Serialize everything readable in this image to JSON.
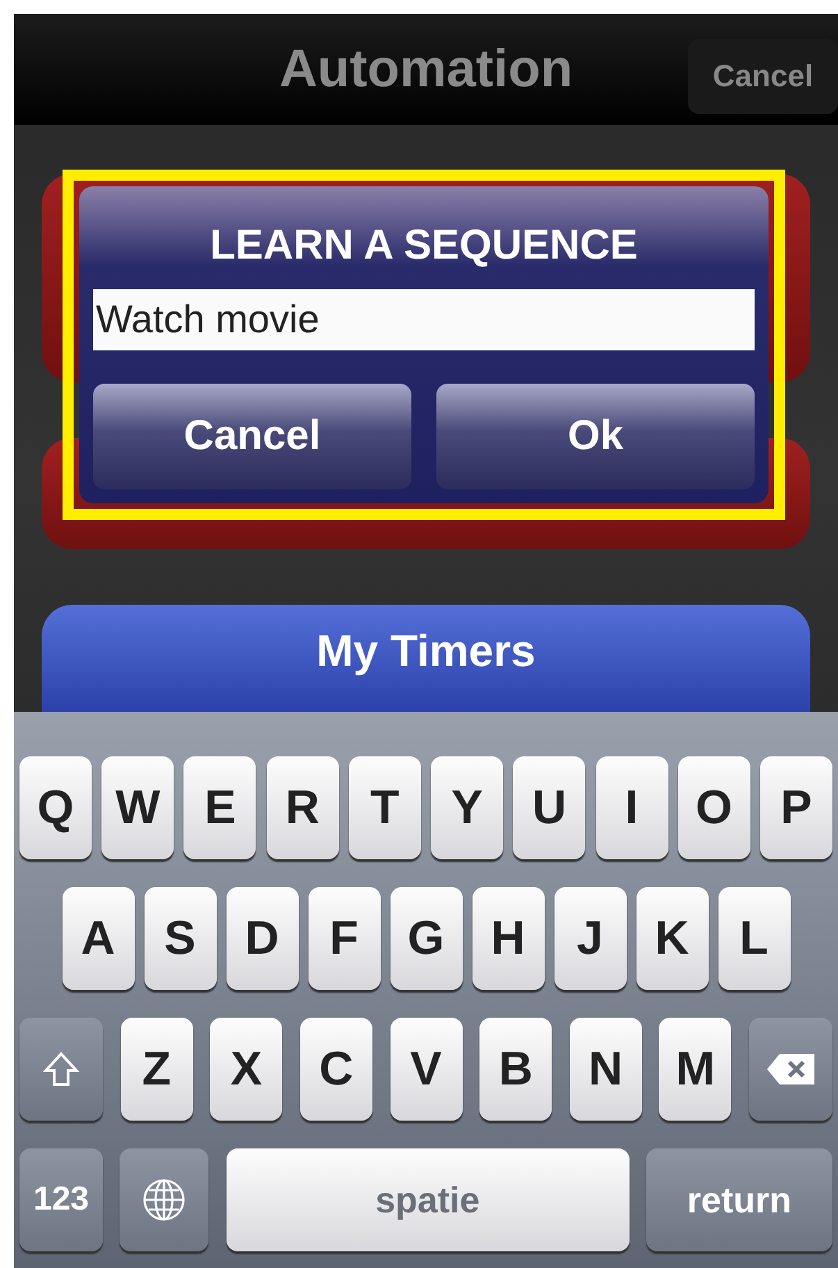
{
  "nav_bar": {
    "title": "Automation",
    "cancel_button": "Cancel"
  },
  "menu": [
    {
      "label": "My Timers"
    }
  ],
  "dialog": {
    "title": "LEARN A SEQUENCE",
    "input": {
      "value": "Watch movie"
    },
    "buttons": [
      "Cancel",
      "Ok"
    ]
  },
  "keyboard": {
    "rows": [
      [
        {
          "kind": "letter",
          "label": "Q"
        },
        {
          "kind": "letter",
          "label": "W"
        },
        {
          "kind": "letter",
          "label": "E"
        },
        {
          "kind": "letter",
          "label": "R"
        },
        {
          "kind": "letter",
          "label": "T"
        },
        {
          "kind": "letter",
          "label": "Y"
        },
        {
          "kind": "letter",
          "label": "U"
        },
        {
          "kind": "letter",
          "label": "I"
        },
        {
          "kind": "letter",
          "label": "O"
        },
        {
          "kind": "letter",
          "label": "P"
        }
      ],
      [
        {
          "kind": "letter",
          "label": "A"
        },
        {
          "kind": "letter",
          "label": "S"
        },
        {
          "kind": "letter",
          "label": "D"
        },
        {
          "kind": "letter",
          "label": "F"
        },
        {
          "kind": "letter",
          "label": "G"
        },
        {
          "kind": "letter",
          "label": "H"
        },
        {
          "kind": "letter",
          "label": "J"
        },
        {
          "kind": "letter",
          "label": "K"
        },
        {
          "kind": "letter",
          "label": "L"
        }
      ],
      [
        {
          "kind": "shift"
        },
        {
          "kind": "letter",
          "label": "Z"
        },
        {
          "kind": "letter",
          "label": "X"
        },
        {
          "kind": "letter",
          "label": "C"
        },
        {
          "kind": "letter",
          "label": "V"
        },
        {
          "kind": "letter",
          "label": "B"
        },
        {
          "kind": "letter",
          "label": "N"
        },
        {
          "kind": "letter",
          "label": "M"
        },
        {
          "kind": "backspace"
        }
      ]
    ],
    "bottom_bar": [
      {
        "kind": "mode",
        "label": "123"
      },
      {
        "kind": "globe"
      },
      {
        "kind": "space",
        "label": "spatie"
      },
      {
        "kind": "return",
        "label": "return"
      }
    ]
  }
}
